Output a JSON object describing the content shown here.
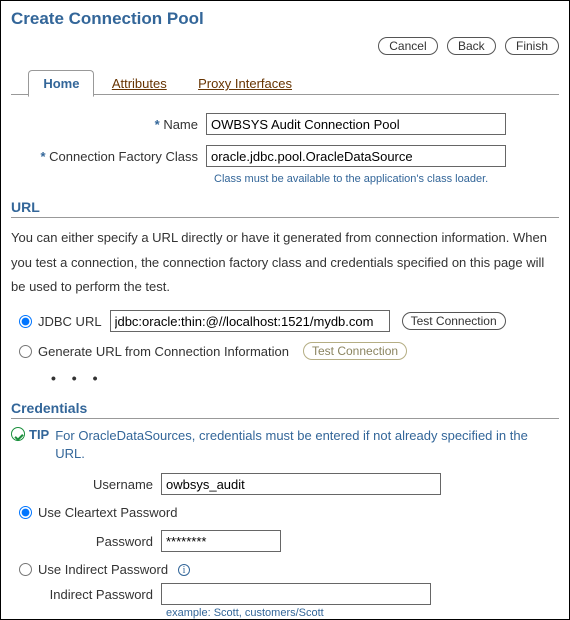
{
  "header": {
    "title": "Create Connection Pool",
    "buttons": {
      "cancel": "Cancel",
      "back": "Back",
      "finish": "Finish"
    }
  },
  "tabs": [
    {
      "label": "Home",
      "active": true
    },
    {
      "label": "Attributes",
      "active": false
    },
    {
      "label": "Proxy Interfaces",
      "active": false
    }
  ],
  "fields": {
    "name_label": "Name",
    "name_value": "OWBSYS Audit Connection Pool",
    "factory_label": "Connection Factory Class",
    "factory_value": "oracle.jdbc.pool.OracleDataSource",
    "factory_helper": "Class must be available to the application's class loader."
  },
  "url_section": {
    "heading": "URL",
    "paragraph": "You can either specify a URL directly or have it generated from connection information. When you test a connection, the connection factory class and credentials specified on this page will be used to perform the test.",
    "jdbc_label": "JDBC URL",
    "jdbc_value": "jdbc:oracle:thin:@//localhost:1521/mydb.com",
    "test_btn": "Test Connection",
    "generate_label": "Generate URL from Connection Information",
    "dots": "• • •"
  },
  "credentials": {
    "heading": "Credentials",
    "tip_label": "TIP",
    "tip_text": "For OracleDataSources, credentials must be entered if not already specified in the URL.",
    "username_label": "Username",
    "username_value": "owbsys_audit",
    "cleartext_label": "Use Cleartext Password",
    "password_label": "Password",
    "password_value": "********",
    "indirect_label": "Use Indirect Password",
    "indirect_pw_label": "Indirect Password",
    "indirect_pw_value": "",
    "example": "example: Scott, customers/Scott"
  }
}
